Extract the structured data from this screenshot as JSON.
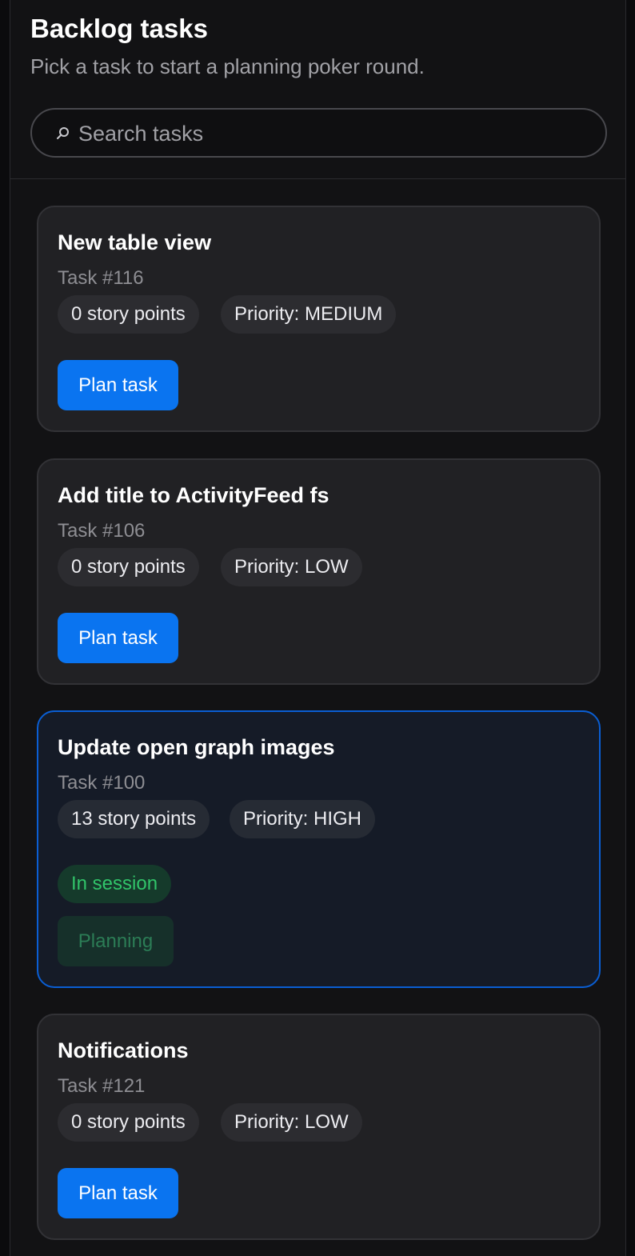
{
  "header": {
    "title": "Backlog tasks",
    "subtitle": "Pick a task to start a planning poker round."
  },
  "search": {
    "placeholder": "Search tasks",
    "value": "",
    "icon": "search-icon"
  },
  "tasks": [
    {
      "title": "New table view",
      "id_label": "Task #116",
      "points_label": "0 story points",
      "priority_label": "Priority: MEDIUM",
      "action_label": "Plan task"
    },
    {
      "title": "Add title to ActivityFeed fs",
      "id_label": "Task #106",
      "points_label": "0 story points",
      "priority_label": "Priority: LOW",
      "action_label": "Plan task"
    },
    {
      "title": "Update open graph images",
      "id_label": "Task #100",
      "points_label": "13 story points",
      "priority_label": "Priority: HIGH",
      "status_label": "In session",
      "action_label": "Planning"
    },
    {
      "title": "Notifications",
      "id_label": "Task #121",
      "points_label": "0 story points",
      "priority_label": "Priority: LOW",
      "action_label": "Plan task"
    }
  ],
  "colors": {
    "accent": "#0a74f0",
    "active_border": "#0a5ed3",
    "session_green": "#31c46a"
  }
}
